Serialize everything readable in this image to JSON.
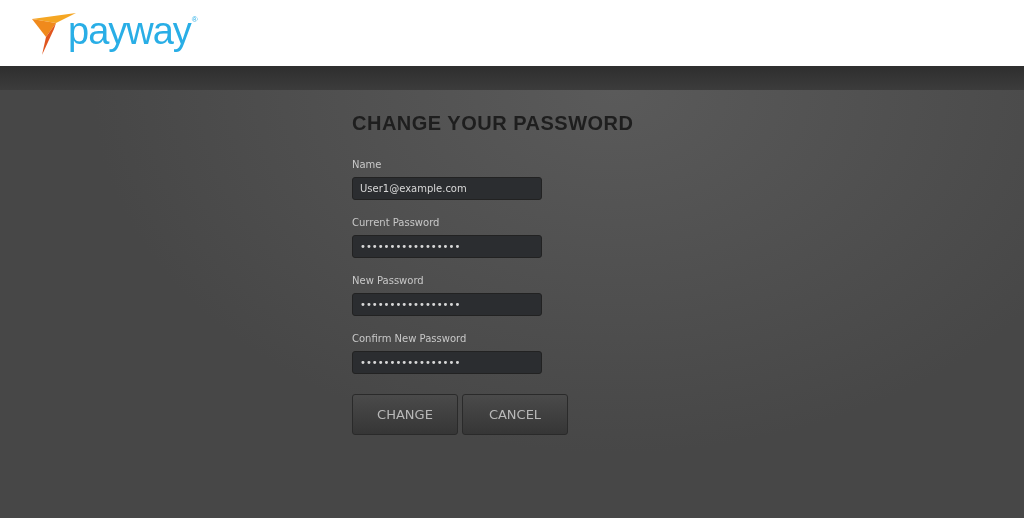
{
  "header": {
    "logo": "payway$^{®}$"
  },
  "form": {
    "title": "CHANGE YOUR PASSWORD",
    "fields": [
      {
        "label": "Name",
        "value": "User1@example.com"
      },
      {
        "label": "Current Password",
        "value": "•••••••••••••••••"
      },
      {
        "label": "New Password",
        "value": "•••••••••••••••••"
      },
      {
        "label": "Confirm New Password",
        "value": "•••••••••••••••••"
      }
    ],
    "buttons": [
      "CHANGE",
      "CANCEL"
    ]
  }
}
